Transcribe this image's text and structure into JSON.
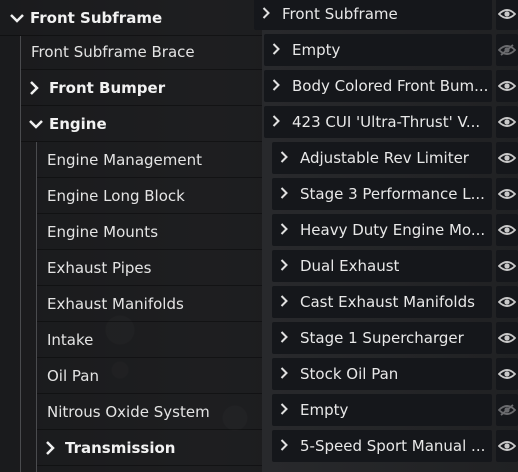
{
  "tree": {
    "root_label": "Front Subframe",
    "brace_label": "Front Subframe Brace",
    "bumper_label": "Front Bumper",
    "engine_label": "Engine",
    "engine_children": [
      "Engine Management",
      "Engine Long Block",
      "Engine Mounts",
      "Exhaust Pipes",
      "Exhaust Manifolds",
      "Intake",
      "Oil Pan",
      "Nitrous Oxide System"
    ],
    "transmission_label": "Transmission"
  },
  "selectors": [
    {
      "value": "Front Subframe",
      "visible": true
    },
    {
      "value": "Empty",
      "visible": false
    },
    {
      "value": "Body Colored Front Bum...",
      "visible": true
    },
    {
      "value": "423 CUI 'Ultra-Thrust' V...",
      "visible": true
    },
    {
      "value": "Adjustable Rev Limiter",
      "visible": true
    },
    {
      "value": "Stage 3 Performance L...",
      "visible": true
    },
    {
      "value": "Heavy Duty Engine Mo...",
      "visible": true
    },
    {
      "value": "Dual Exhaust",
      "visible": true
    },
    {
      "value": "Cast Exhaust Manifolds",
      "visible": true
    },
    {
      "value": "Stage 1 Supercharger",
      "visible": true
    },
    {
      "value": "Stock Oil Pan",
      "visible": true
    },
    {
      "value": "Empty",
      "visible": false
    },
    {
      "value": "5-Speed Sport Manual ...",
      "visible": true
    }
  ],
  "icons": {
    "expanded": "chevron-down-icon",
    "collapsed": "chevron-right-icon",
    "visible": "eye-icon",
    "hidden": "eye-slash-icon"
  },
  "colors": {
    "panel": "#15171b",
    "text": "#e4e4e4",
    "icon": "#c8c8c8",
    "icon_disabled": "#6a6b6e"
  }
}
